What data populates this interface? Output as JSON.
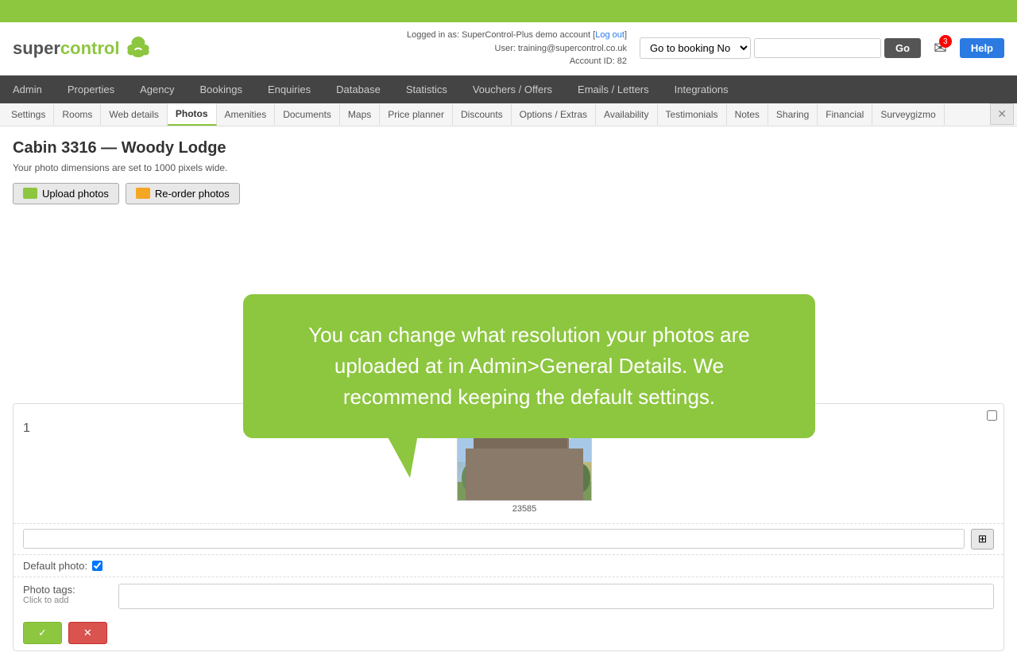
{
  "top_banner": {},
  "header": {
    "logo_super": "super",
    "logo_control": "control",
    "logged_in_text": "Logged in as: SuperControl-Plus demo account",
    "logout_link": "Log out",
    "user_text": "User: training@supercontrol.co.uk",
    "account_text": "Account ID: 82",
    "booking_label": "Go to booking No",
    "go_button": "Go",
    "help_button": "Help",
    "mail_count": "3"
  },
  "main_nav": {
    "items": [
      {
        "label": "Admin",
        "active": false
      },
      {
        "label": "Properties",
        "active": false
      },
      {
        "label": "Agency",
        "active": false
      },
      {
        "label": "Bookings",
        "active": false
      },
      {
        "label": "Enquiries",
        "active": false
      },
      {
        "label": "Database",
        "active": false
      },
      {
        "label": "Statistics",
        "active": false
      },
      {
        "label": "Vouchers / Offers",
        "active": false
      },
      {
        "label": "Emails / Letters",
        "active": false
      },
      {
        "label": "Integrations",
        "active": false
      }
    ]
  },
  "sub_nav": {
    "items": [
      {
        "label": "Settings",
        "active": false
      },
      {
        "label": "Rooms",
        "active": false
      },
      {
        "label": "Web details",
        "active": false
      },
      {
        "label": "Photos",
        "active": true
      },
      {
        "label": "Amenities",
        "active": false
      },
      {
        "label": "Documents",
        "active": false
      },
      {
        "label": "Maps",
        "active": false
      },
      {
        "label": "Price planner",
        "active": false
      },
      {
        "label": "Discounts",
        "active": false
      },
      {
        "label": "Options / Extras",
        "active": false
      },
      {
        "label": "Availability",
        "active": false
      },
      {
        "label": "Testimonials",
        "active": false
      },
      {
        "label": "Notes",
        "active": false
      },
      {
        "label": "Sharing",
        "active": false
      },
      {
        "label": "Financial",
        "active": false
      },
      {
        "label": "Surveygizmo",
        "active": false
      }
    ]
  },
  "page": {
    "title": "Cabin 3316 — Woody Lodge",
    "photo_info": "Your photo dimensions are set to 1000 pixels wide.",
    "upload_button": "Upload photos",
    "reorder_button": "Re-order photos",
    "tooltip_text": "You can change what resolution your photos are uploaded at in Admin>General Details. We recommend keeping the default settings.",
    "photo_number": "1",
    "photo_caption_id": "23585",
    "default_photo_label": "Default photo:",
    "photo_tags_label": "Photo tags:",
    "photo_tags_sub": "Click to add",
    "caption_input_placeholder": "",
    "tags_input_placeholder": ""
  }
}
